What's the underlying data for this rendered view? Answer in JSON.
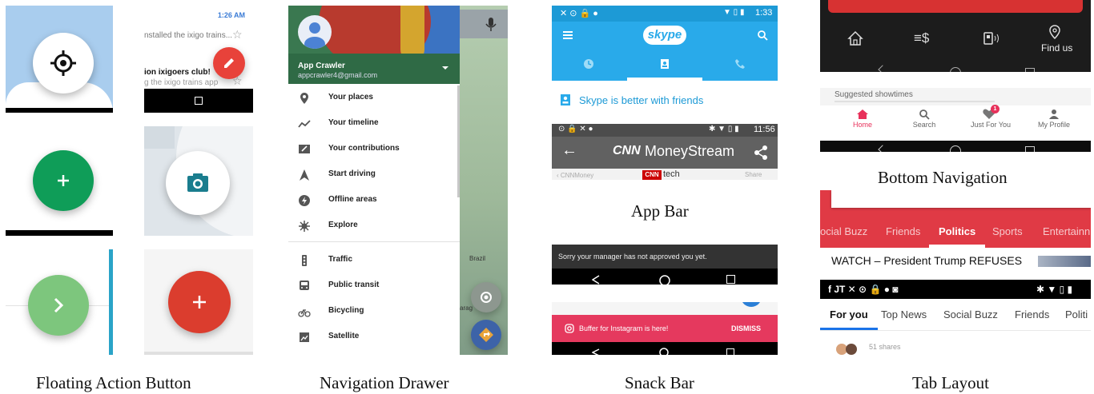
{
  "fab": {
    "caption": "Floating Action Button",
    "notification_time": "1:26 AM",
    "notification_text1": "nstalled the ixigo trains...",
    "notification_text2": "ion ixigoers club!",
    "notification_text3": "g the ixigo trains app",
    "colors": {
      "green": "#0f9d58",
      "red": "#db3d2e",
      "light_green": "#7dc67d",
      "camera": "#1a7d8e"
    }
  },
  "drawer": {
    "caption": "Navigation Drawer",
    "user_name": "App Crawler",
    "user_email": "appcrawler4@gmail.com",
    "items": [
      {
        "label": "Your places",
        "icon": "pin-icon"
      },
      {
        "label": "Your timeline",
        "icon": "timeline-icon"
      },
      {
        "label": "Your contributions",
        "icon": "contributions-icon"
      },
      {
        "label": "Start driving",
        "icon": "navigation-arrow-icon"
      },
      {
        "label": "Offline areas",
        "icon": "offline-icon"
      },
      {
        "label": "Explore",
        "icon": "explore-icon"
      },
      {
        "label": "Traffic",
        "icon": "traffic-icon"
      },
      {
        "label": "Public transit",
        "icon": "transit-icon"
      },
      {
        "label": "Bicycling",
        "icon": "bicycle-icon"
      },
      {
        "label": "Satellite",
        "icon": "satellite-icon"
      }
    ],
    "map_label": "Brazil",
    "map_label2": "arag"
  },
  "appbar": {
    "caption": "App Bar",
    "skype_time": "1:33",
    "skype_logo": "skype",
    "skype_banner": "Skype is better with friends",
    "cnn_time": "11:56",
    "cnn_title": "MoneyStream",
    "cnn_logo": "CNN",
    "cnn_sub_left": "CNNMoney",
    "cnn_sub_tech": "tech",
    "cnn_sub_tech_logo": "CNN",
    "cnn_sub_share": "Share"
  },
  "snackbar": {
    "caption": "Snack Bar",
    "message1": "Sorry your manager has not approved you yet.",
    "message2": "Buffer for Instagram is here!",
    "action2": "DISMISS"
  },
  "bottomnav": {
    "caption": "Bottom Navigation",
    "find_us": "Find us",
    "suggested": "Suggested showtimes",
    "items": [
      {
        "label": "Home",
        "icon": "home-icon"
      },
      {
        "label": "Search",
        "icon": "search-icon"
      },
      {
        "label": "Just For You",
        "icon": "heart-icon"
      },
      {
        "label": "My Profile",
        "icon": "person-icon"
      }
    ],
    "badge": "1"
  },
  "tablayout": {
    "caption": "Tab Layout",
    "red_tabs": [
      "ocial Buzz",
      "Friends",
      "Politics",
      "Sports",
      "Entertainn"
    ],
    "headline": "WATCH – President Trump REFUSES",
    "white_tabs": [
      "For you",
      "Top News",
      "Social Buzz",
      "Friends",
      "Politi"
    ],
    "shares": "51 shares"
  }
}
